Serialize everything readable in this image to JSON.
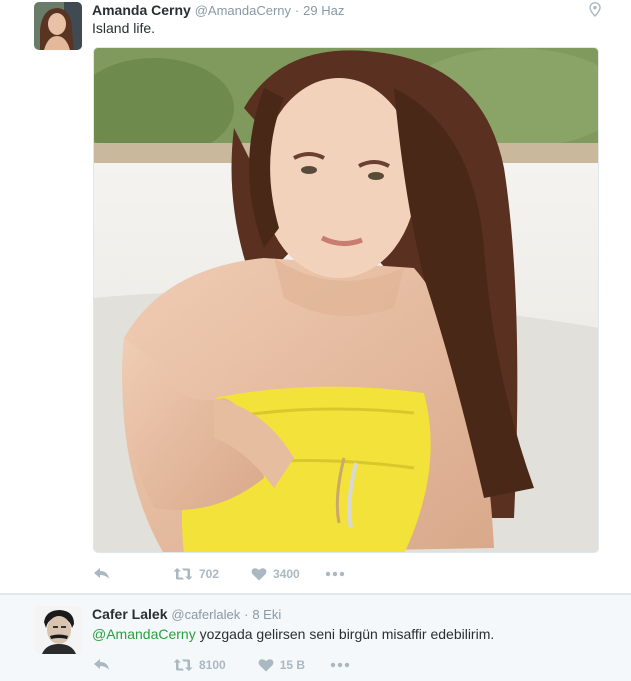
{
  "tweets": [
    {
      "fullname": "Amanda Cerny",
      "handle": "@AmandaCerny",
      "separator": "·",
      "time": "29 Haz",
      "text": "Island life.",
      "retweets": "702",
      "likes": "3400"
    },
    {
      "fullname": "Cafer Lalek",
      "handle": "@caferlalek",
      "separator": "·",
      "time": "8 Eki",
      "mention": "@AmandaCerny",
      "text": " yozgada gelirsen seni birgün misaffir edebilirim.",
      "retweets": "8100",
      "likes": "15 B"
    }
  ],
  "colors": {
    "accent_mention": "#2a9f3f",
    "meta_gray": "#8899a6",
    "action_gray": "#aab8c2",
    "towel_yellow": "#f2e23a",
    "sand": "#efeeea"
  }
}
